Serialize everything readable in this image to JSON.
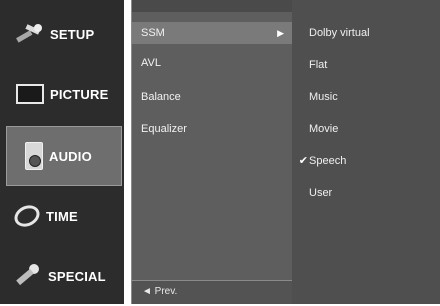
{
  "main_menu": {
    "items": [
      {
        "label": "SETUP",
        "icon": "wrench-icon"
      },
      {
        "label": "PICTURE",
        "icon": "picture-icon"
      },
      {
        "label": "AUDIO",
        "icon": "speaker-icon"
      },
      {
        "label": "TIME",
        "icon": "clock-icon"
      },
      {
        "label": "SPECIAL",
        "icon": "special-icon"
      }
    ],
    "selected": "AUDIO"
  },
  "audio_menu": {
    "items": [
      {
        "label": "SSM",
        "has_submenu": true
      },
      {
        "label": "AVL"
      },
      {
        "label": "Balance"
      },
      {
        "label": "Equalizer"
      }
    ],
    "selected": "SSM",
    "footer_label": "◄ Prev."
  },
  "ssm_options": {
    "items": [
      {
        "label": "Dolby virtual"
      },
      {
        "label": "Flat"
      },
      {
        "label": "Music"
      },
      {
        "label": "Movie"
      },
      {
        "label": "Speech"
      },
      {
        "label": "User"
      }
    ],
    "checked": "Speech",
    "check_mark": "✔"
  }
}
